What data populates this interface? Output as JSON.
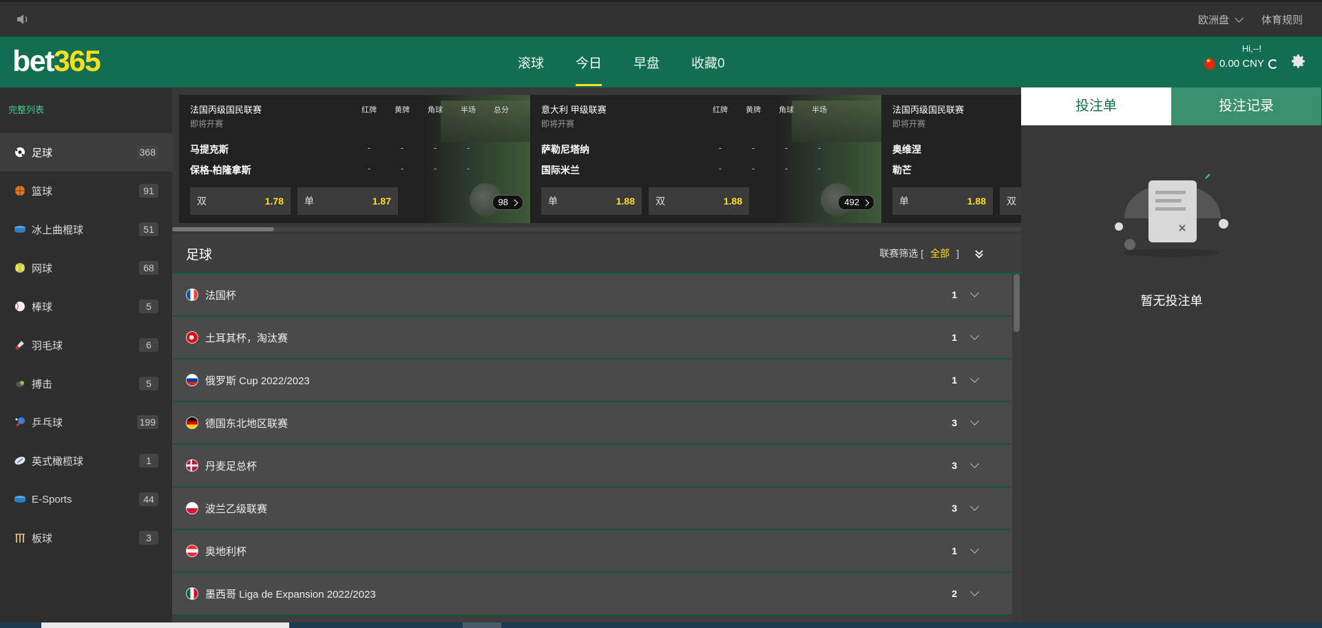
{
  "topbar": {
    "odds_format": "欧洲盘",
    "rules": "体育规则"
  },
  "header": {
    "logo_main": "bet",
    "logo_accent": "365",
    "nav": [
      {
        "label": "滚球"
      },
      {
        "label": "今日"
      },
      {
        "label": "早盘"
      },
      {
        "label": "收藏0"
      }
    ],
    "active_nav": "今日",
    "greeting": "Hi,--!",
    "balance": "0.00 CNY"
  },
  "sidebar": {
    "title": "完整列表",
    "sports": [
      {
        "name": "足球",
        "count": "368",
        "icon": "soccer-ball-icon"
      },
      {
        "name": "篮球",
        "count": "91",
        "icon": "basketball-icon"
      },
      {
        "name": "冰上曲棍球",
        "count": "51",
        "icon": "hockey-puck-icon"
      },
      {
        "name": "网球",
        "count": "68",
        "icon": "tennis-ball-icon"
      },
      {
        "name": "棒球",
        "count": "5",
        "icon": "baseball-icon"
      },
      {
        "name": "羽毛球",
        "count": "6",
        "icon": "shuttlecock-icon"
      },
      {
        "name": "搏击",
        "count": "5",
        "icon": "boxing-icon"
      },
      {
        "name": "乒乓球",
        "count": "199",
        "icon": "table-tennis-icon"
      },
      {
        "name": "英式橄榄球",
        "count": "1",
        "icon": "rugby-ball-icon"
      },
      {
        "name": "E-Sports",
        "count": "44",
        "icon": "esports-icon"
      },
      {
        "name": "板球",
        "count": "3",
        "icon": "cricket-icon"
      }
    ]
  },
  "featured": {
    "columns": [
      "红牌",
      "黄牌",
      "角球",
      "半场",
      "总分"
    ],
    "cards": [
      {
        "league": "法国丙级国民联赛",
        "status": "即将开赛",
        "home": "马提克斯",
        "away": "保格-柏隆拿斯",
        "odds": [
          {
            "label": "双",
            "value": "1.78"
          },
          {
            "label": "单",
            "value": "1.87"
          }
        ],
        "more": "98"
      },
      {
        "league": "意大利 甲级联赛",
        "status": "即将开赛",
        "home": "萨勒尼塔纳",
        "away": "国际米兰",
        "odds": [
          {
            "label": "单",
            "value": "1.88"
          },
          {
            "label": "双",
            "value": "1.88"
          }
        ],
        "more": "492"
      },
      {
        "league": "法国丙级国民联赛",
        "status": "即将开赛",
        "home": "奥维涅",
        "away": "勒芒",
        "odds": [
          {
            "label": "单",
            "value": "1.88"
          },
          {
            "label": "双",
            "value": ""
          }
        ],
        "more": ""
      }
    ]
  },
  "main": {
    "title": "足球",
    "filter_label": "联赛筛选 [",
    "filter_value": "全部",
    "filter_close": "]",
    "leagues": [
      {
        "name": "法国杯",
        "count": "1",
        "flag": "france"
      },
      {
        "name": "土耳其杯，淘汰赛",
        "count": "1",
        "flag": "turkey"
      },
      {
        "name": "俄罗斯 Cup 2022/2023",
        "count": "1",
        "flag": "russia"
      },
      {
        "name": "德国东北地区联赛",
        "count": "3",
        "flag": "germany"
      },
      {
        "name": "丹麦足总杯",
        "count": "3",
        "flag": "denmark"
      },
      {
        "name": "波兰乙级联赛",
        "count": "3",
        "flag": "poland"
      },
      {
        "name": "奥地利杯",
        "count": "1",
        "flag": "austria"
      },
      {
        "name": "墨西哥 Liga de Expansion 2022/2023",
        "count": "2",
        "flag": "mexico"
      }
    ]
  },
  "betslip": {
    "tab_slip": "投注单",
    "tab_history": "投注记录",
    "empty": "暂无投注单"
  },
  "colors": {
    "brand_green": "#126e51",
    "accent_yellow": "#ffdf1b"
  }
}
